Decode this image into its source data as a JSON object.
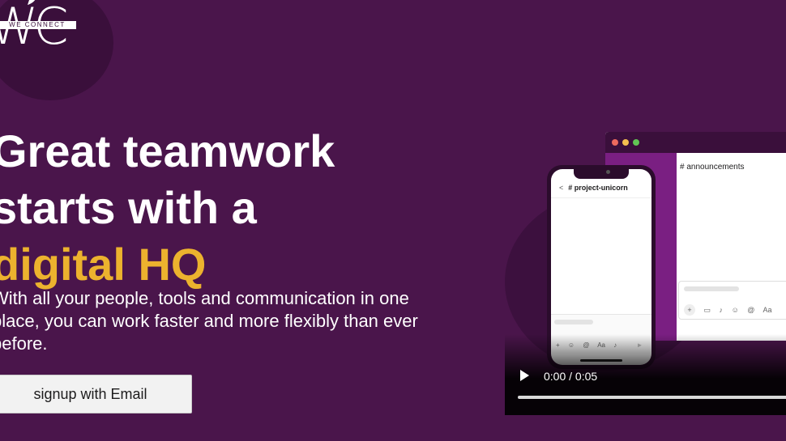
{
  "logo": {
    "tagline": "WE CONNECT",
    "mark": "WC"
  },
  "hero": {
    "headline_line1": "Great teamwork",
    "headline_line2": "starts with a",
    "headline_accent": "digital HQ",
    "subtext": "With all your people, tools and communication in one place, you can work faster and more flexibly than ever before.",
    "signup_label": "signup with Email"
  },
  "video": {
    "desktop_channel": "# announcements",
    "phone_channel": "# project-unicorn",
    "time_display": "0:00 / 0:05",
    "progress": 0
  },
  "colors": {
    "background": "#4a154b",
    "accent": "#ecb22e",
    "sidebar": "#7a1f82"
  }
}
